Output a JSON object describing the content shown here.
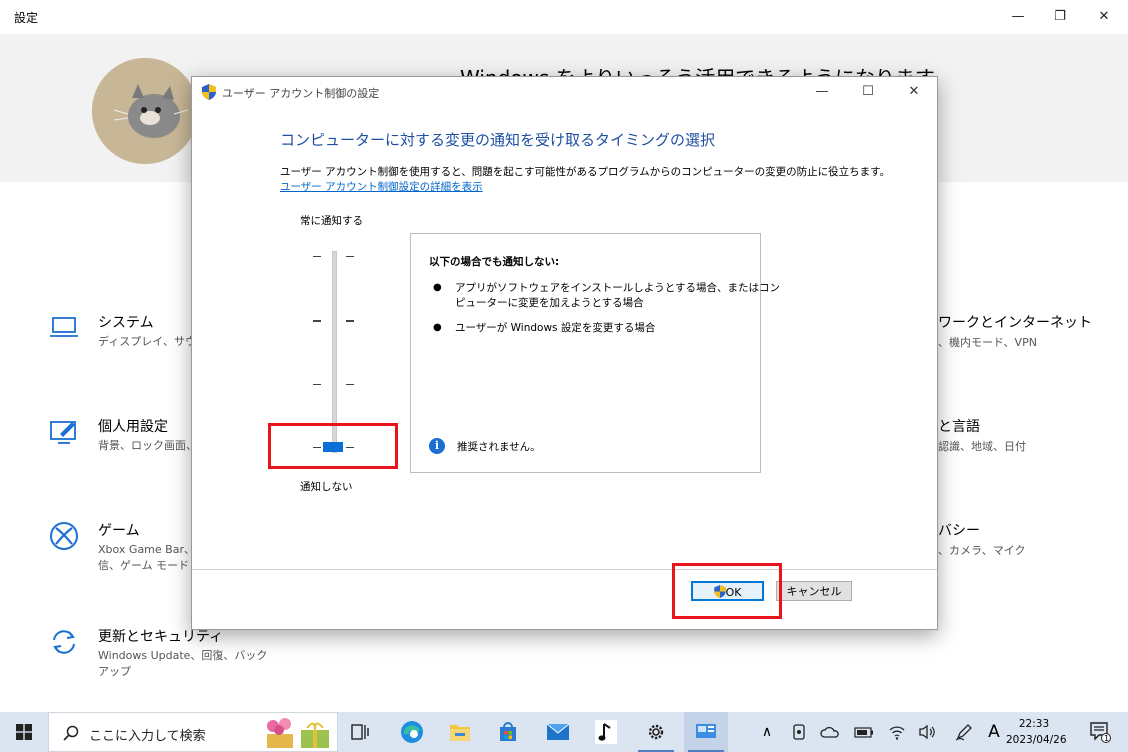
{
  "settings": {
    "title": "設定",
    "hero_text": "Windows をよりいっそう活用できるようになります",
    "categories_left": [
      {
        "title": "システム",
        "sub": "ディスプレイ、サウンド"
      },
      {
        "title": "個人用設定",
        "sub": "背景、ロック画面、色"
      },
      {
        "title": "ゲーム",
        "sub": "Xbox Game Bar、キャプチャ、ブロードキャスト、ゲーム モード",
        "sub1": "Xbox Game Bar、",
        "sub2": "信、ゲーム モード"
      },
      {
        "title": "更新とセキュリティ",
        "sub1": "Windows Update、回復、バック",
        "sub2": "アップ"
      }
    ],
    "categories_right": [
      {
        "title": "ネットワークとインターネット",
        "title_visible": "ワークとインターネット",
        "sub": "Wi-Fi、機内モード、VPN",
        "sub_visible": "、機内モード、VPN"
      },
      {
        "title_visible": "と言語",
        "sub_visible": "認識、地域、日付"
      },
      {
        "title_visible": "バシー",
        "sub_visible": "、カメラ、マイク"
      }
    ]
  },
  "dialog": {
    "title": "ユーザー アカウント制御の設定",
    "heading": "コンピューターに対する変更の通知を受け取るタイミングの選択",
    "description": "ユーザー アカウント制御を使用すると、問題を起こす可能性があるプログラムからのコンピューターの変更の防止に役立ちます。",
    "link": "ユーザー アカウント制御設定の詳細を表示",
    "slider_top_label": "常に通知する",
    "slider_bottom_label": "通知しない",
    "slider_level": 0,
    "slider_levels": 4,
    "info_heading": "以下の場合でも通知しない:",
    "info_bullets": [
      {
        "line1": "アプリがソフトウェアをインストールしようとする場合、またはコン",
        "line2": "ピューターに変更を加えようとする場合"
      },
      {
        "line1": "ユーザーが Windows 設定を変更する場合"
      }
    ],
    "info_note": "推奨されません。",
    "ok_label": "OK",
    "cancel_label": "キャンセル"
  },
  "taskbar": {
    "search_placeholder": "ここに入力して検索",
    "time": "22:33",
    "date": "2023/04/26",
    "ime": "A",
    "notification_count": "1"
  },
  "colors": {
    "accent": "#0a6fd6",
    "heading_blue": "#1e4fa3",
    "highlight_red": "#e8141b",
    "taskbar": "#dbe4f1"
  }
}
